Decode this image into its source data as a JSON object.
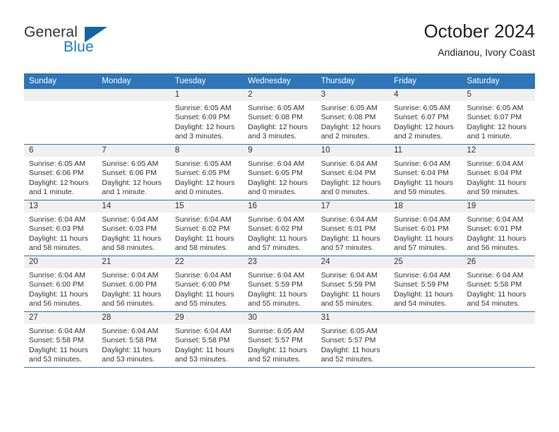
{
  "branding": {
    "name_primary": "General",
    "name_secondary": "Blue",
    "triangle_color": "#1464a5",
    "blue_color": "#1f7ac4"
  },
  "header": {
    "month_title": "October 2024",
    "location": "Andianou, Ivory Coast"
  },
  "theme": {
    "header_blue": "#2e76b8",
    "band_gray": "#f0f0f0",
    "text_color": "#333333"
  },
  "weekday_headers": [
    "Sunday",
    "Monday",
    "Tuesday",
    "Wednesday",
    "Thursday",
    "Friday",
    "Saturday"
  ],
  "weeks": [
    [
      {
        "day": "",
        "sunrise": "",
        "sunset": "",
        "daylight_line1": "",
        "daylight_line2": ""
      },
      {
        "day": "",
        "sunrise": "",
        "sunset": "",
        "daylight_line1": "",
        "daylight_line2": ""
      },
      {
        "day": "1",
        "sunrise": "Sunrise: 6:05 AM",
        "sunset": "Sunset: 6:09 PM",
        "daylight_line1": "Daylight: 12 hours",
        "daylight_line2": "and 3 minutes."
      },
      {
        "day": "2",
        "sunrise": "Sunrise: 6:05 AM",
        "sunset": "Sunset: 6:08 PM",
        "daylight_line1": "Daylight: 12 hours",
        "daylight_line2": "and 3 minutes."
      },
      {
        "day": "3",
        "sunrise": "Sunrise: 6:05 AM",
        "sunset": "Sunset: 6:08 PM",
        "daylight_line1": "Daylight: 12 hours",
        "daylight_line2": "and 2 minutes."
      },
      {
        "day": "4",
        "sunrise": "Sunrise: 6:05 AM",
        "sunset": "Sunset: 6:07 PM",
        "daylight_line1": "Daylight: 12 hours",
        "daylight_line2": "and 2 minutes."
      },
      {
        "day": "5",
        "sunrise": "Sunrise: 6:05 AM",
        "sunset": "Sunset: 6:07 PM",
        "daylight_line1": "Daylight: 12 hours",
        "daylight_line2": "and 1 minute."
      }
    ],
    [
      {
        "day": "6",
        "sunrise": "Sunrise: 6:05 AM",
        "sunset": "Sunset: 6:06 PM",
        "daylight_line1": "Daylight: 12 hours",
        "daylight_line2": "and 1 minute."
      },
      {
        "day": "7",
        "sunrise": "Sunrise: 6:05 AM",
        "sunset": "Sunset: 6:06 PM",
        "daylight_line1": "Daylight: 12 hours",
        "daylight_line2": "and 1 minute."
      },
      {
        "day": "8",
        "sunrise": "Sunrise: 6:05 AM",
        "sunset": "Sunset: 6:05 PM",
        "daylight_line1": "Daylight: 12 hours",
        "daylight_line2": "and 0 minutes."
      },
      {
        "day": "9",
        "sunrise": "Sunrise: 6:04 AM",
        "sunset": "Sunset: 6:05 PM",
        "daylight_line1": "Daylight: 12 hours",
        "daylight_line2": "and 0 minutes."
      },
      {
        "day": "10",
        "sunrise": "Sunrise: 6:04 AM",
        "sunset": "Sunset: 6:04 PM",
        "daylight_line1": "Daylight: 12 hours",
        "daylight_line2": "and 0 minutes."
      },
      {
        "day": "11",
        "sunrise": "Sunrise: 6:04 AM",
        "sunset": "Sunset: 6:04 PM",
        "daylight_line1": "Daylight: 11 hours",
        "daylight_line2": "and 59 minutes."
      },
      {
        "day": "12",
        "sunrise": "Sunrise: 6:04 AM",
        "sunset": "Sunset: 6:04 PM",
        "daylight_line1": "Daylight: 11 hours",
        "daylight_line2": "and 59 minutes."
      }
    ],
    [
      {
        "day": "13",
        "sunrise": "Sunrise: 6:04 AM",
        "sunset": "Sunset: 6:03 PM",
        "daylight_line1": "Daylight: 11 hours",
        "daylight_line2": "and 58 minutes."
      },
      {
        "day": "14",
        "sunrise": "Sunrise: 6:04 AM",
        "sunset": "Sunset: 6:03 PM",
        "daylight_line1": "Daylight: 11 hours",
        "daylight_line2": "and 58 minutes."
      },
      {
        "day": "15",
        "sunrise": "Sunrise: 6:04 AM",
        "sunset": "Sunset: 6:02 PM",
        "daylight_line1": "Daylight: 11 hours",
        "daylight_line2": "and 58 minutes."
      },
      {
        "day": "16",
        "sunrise": "Sunrise: 6:04 AM",
        "sunset": "Sunset: 6:02 PM",
        "daylight_line1": "Daylight: 11 hours",
        "daylight_line2": "and 57 minutes."
      },
      {
        "day": "17",
        "sunrise": "Sunrise: 6:04 AM",
        "sunset": "Sunset: 6:01 PM",
        "daylight_line1": "Daylight: 11 hours",
        "daylight_line2": "and 57 minutes."
      },
      {
        "day": "18",
        "sunrise": "Sunrise: 6:04 AM",
        "sunset": "Sunset: 6:01 PM",
        "daylight_line1": "Daylight: 11 hours",
        "daylight_line2": "and 57 minutes."
      },
      {
        "day": "19",
        "sunrise": "Sunrise: 6:04 AM",
        "sunset": "Sunset: 6:01 PM",
        "daylight_line1": "Daylight: 11 hours",
        "daylight_line2": "and 56 minutes."
      }
    ],
    [
      {
        "day": "20",
        "sunrise": "Sunrise: 6:04 AM",
        "sunset": "Sunset: 6:00 PM",
        "daylight_line1": "Daylight: 11 hours",
        "daylight_line2": "and 56 minutes."
      },
      {
        "day": "21",
        "sunrise": "Sunrise: 6:04 AM",
        "sunset": "Sunset: 6:00 PM",
        "daylight_line1": "Daylight: 11 hours",
        "daylight_line2": "and 56 minutes."
      },
      {
        "day": "22",
        "sunrise": "Sunrise: 6:04 AM",
        "sunset": "Sunset: 6:00 PM",
        "daylight_line1": "Daylight: 11 hours",
        "daylight_line2": "and 55 minutes."
      },
      {
        "day": "23",
        "sunrise": "Sunrise: 6:04 AM",
        "sunset": "Sunset: 5:59 PM",
        "daylight_line1": "Daylight: 11 hours",
        "daylight_line2": "and 55 minutes."
      },
      {
        "day": "24",
        "sunrise": "Sunrise: 6:04 AM",
        "sunset": "Sunset: 5:59 PM",
        "daylight_line1": "Daylight: 11 hours",
        "daylight_line2": "and 55 minutes."
      },
      {
        "day": "25",
        "sunrise": "Sunrise: 6:04 AM",
        "sunset": "Sunset: 5:59 PM",
        "daylight_line1": "Daylight: 11 hours",
        "daylight_line2": "and 54 minutes."
      },
      {
        "day": "26",
        "sunrise": "Sunrise: 6:04 AM",
        "sunset": "Sunset: 5:58 PM",
        "daylight_line1": "Daylight: 11 hours",
        "daylight_line2": "and 54 minutes."
      }
    ],
    [
      {
        "day": "27",
        "sunrise": "Sunrise: 6:04 AM",
        "sunset": "Sunset: 5:58 PM",
        "daylight_line1": "Daylight: 11 hours",
        "daylight_line2": "and 53 minutes."
      },
      {
        "day": "28",
        "sunrise": "Sunrise: 6:04 AM",
        "sunset": "Sunset: 5:58 PM",
        "daylight_line1": "Daylight: 11 hours",
        "daylight_line2": "and 53 minutes."
      },
      {
        "day": "29",
        "sunrise": "Sunrise: 6:04 AM",
        "sunset": "Sunset: 5:58 PM",
        "daylight_line1": "Daylight: 11 hours",
        "daylight_line2": "and 53 minutes."
      },
      {
        "day": "30",
        "sunrise": "Sunrise: 6:05 AM",
        "sunset": "Sunset: 5:57 PM",
        "daylight_line1": "Daylight: 11 hours",
        "daylight_line2": "and 52 minutes."
      },
      {
        "day": "31",
        "sunrise": "Sunrise: 6:05 AM",
        "sunset": "Sunset: 5:57 PM",
        "daylight_line1": "Daylight: 11 hours",
        "daylight_line2": "and 52 minutes."
      },
      {
        "day": "",
        "sunrise": "",
        "sunset": "",
        "daylight_line1": "",
        "daylight_line2": ""
      },
      {
        "day": "",
        "sunrise": "",
        "sunset": "",
        "daylight_line1": "",
        "daylight_line2": ""
      }
    ]
  ]
}
